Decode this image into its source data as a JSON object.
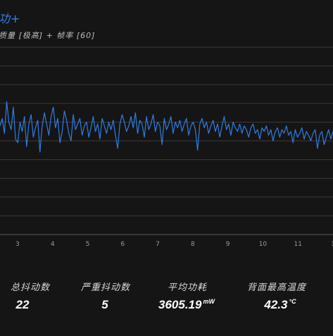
{
  "header": {
    "title": "功+",
    "subtitle": "质量 [极高] + 帧率 [60]"
  },
  "chart_data": {
    "type": "line",
    "x_ticks": [
      "3",
      "4",
      "5",
      "6",
      "7",
      "8",
      "9",
      "10",
      "11",
      "1"
    ],
    "xlim": [
      2.5,
      12
    ],
    "ylim": [
      0,
      10
    ],
    "grid": true,
    "line_color": "#2f7de1",
    "series": [
      {
        "values": [
          5.8,
          6.2,
          5.4,
          7.1,
          6.0,
          5.6,
          6.8,
          5.1,
          4.9,
          6.0,
          5.5,
          6.3,
          4.7,
          5.9,
          6.4,
          5.2,
          5.7,
          6.1,
          4.4,
          5.8,
          6.5,
          5.9,
          5.3,
          6.3,
          6.8,
          5.7,
          6.2,
          4.9,
          5.5,
          6.6,
          6.1,
          5.4,
          5.0,
          6.4,
          5.6,
          5.9,
          6.2,
          5.3,
          5.8,
          6.0,
          5.2,
          5.7,
          6.3,
          5.5,
          5.9,
          5.1,
          6.2,
          5.8,
          5.4,
          6.0,
          5.6,
          6.1,
          5.3,
          4.6,
          5.9,
          6.4,
          6.0,
          5.5,
          5.8,
          6.3,
          5.7,
          6.5,
          5.4,
          6.1,
          5.9,
          5.2,
          6.3,
          5.6,
          5.9,
          6.4,
          5.5,
          6.0,
          5.8,
          4.8,
          6.2,
          5.6,
          5.9,
          6.3,
          5.4,
          6.0,
          5.7,
          6.1,
          5.5,
          5.9,
          6.2,
          5.3,
          5.8,
          6.0,
          5.6,
          4.5,
          5.9,
          6.2,
          5.7,
          6.0,
          5.4,
          5.8,
          6.1,
          5.5,
          5.9,
          5.2,
          5.8,
          6.3,
          5.6,
          5.9,
          5.3,
          6.0,
          5.7,
          5.5,
          5.9,
          5.4,
          5.8,
          5.6,
          5.2,
          5.7,
          5.9,
          5.4,
          5.6,
          5.1,
          5.7,
          5.5,
          5.8,
          5.3,
          5.6,
          5.0,
          5.5,
          5.7,
          5.2,
          5.6,
          5.4,
          5.8,
          5.3,
          5.5,
          4.9,
          5.6,
          5.2,
          5.4,
          5.7,
          5.1,
          5.5,
          5.3,
          5.0,
          5.4,
          5.6,
          4.6,
          5.3,
          5.5,
          4.8,
          5.2,
          5.6,
          5.1,
          5.5
        ]
      }
    ]
  },
  "stats": [
    {
      "label": "总抖动数",
      "value": "22",
      "unit": ""
    },
    {
      "label": "严重抖动数",
      "value": "5",
      "unit": ""
    },
    {
      "label": "平均功耗",
      "value": "3605.19",
      "unit": "mW"
    },
    {
      "label": "背面最高温度",
      "value": "42.3",
      "unit": "°C"
    }
  ]
}
